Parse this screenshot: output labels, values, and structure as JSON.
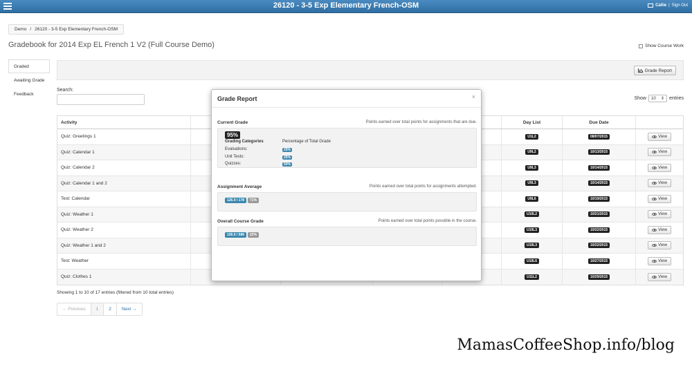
{
  "header": {
    "title": "26120 - 3-5 Exp Elementary French-OSM",
    "user_name": "Callie",
    "sign_out": "Sign Out"
  },
  "breadcrumb": [
    "Demo",
    "/",
    "26120 - 3-5 Exp Elementary French-OSM"
  ],
  "page_title": "Gradebook for 2014 Exp EL French 1 V2 (Full Course Demo)",
  "show_course_work": "Show Course Work",
  "side_tabs": [
    "Graded",
    "Awaiting Grade",
    "Feedback"
  ],
  "toolbar": {
    "grade_report_label": "Grade Report"
  },
  "search": {
    "label": "Search:",
    "value": ""
  },
  "entries": {
    "prefix": "Show",
    "value": "10",
    "suffix": "entries"
  },
  "table": {
    "headers": [
      "Activity",
      "",
      "",
      "",
      "",
      "Day List",
      "Due Date",
      ""
    ],
    "view_label": "View",
    "rows": [
      {
        "activity": "Quiz: Greetings 1",
        "day": "U1L2",
        "due": "08/07/2015"
      },
      {
        "activity": "Quiz: Calendar 1",
        "day": "U9L2",
        "due": "10/13/2015"
      },
      {
        "activity": "Quiz: Calendar 2",
        "day": "U9L3",
        "due": "10/14/2015"
      },
      {
        "activity": "Quiz: Calendar 1 and 2",
        "day": "U9L3",
        "due": "10/14/2015"
      },
      {
        "activity": "Test: Calendar",
        "day": "U9L6",
        "due": "10/19/2015"
      },
      {
        "activity": "Quiz: Weather 1",
        "day": "U10L2",
        "due": "10/21/2015"
      },
      {
        "activity": "Quiz: Weather 2",
        "day": "U10L3",
        "due": "10/22/2015"
      },
      {
        "activity": "Quiz: Weather 1 and 2",
        "day": "U10L3",
        "due": "10/22/2015"
      },
      {
        "activity": "Test: Weather",
        "day": "U10L6",
        "due": "10/27/2015"
      },
      {
        "activity": "Quiz: Clothes 1",
        "day": "U11L2",
        "due": "10/29/2015"
      }
    ]
  },
  "showing_text": "Showing 1 to 10 of 17 entries (filtered from 10 total entries)",
  "pagination": {
    "prev": "← Previous",
    "pages": [
      "1",
      "2"
    ],
    "next": "Next →"
  },
  "modal": {
    "title": "Grade Report",
    "close": "×",
    "current_grade": {
      "title": "Current Grade",
      "desc": "Points earned over total points for assignments that are due.",
      "value": "95%",
      "categories_head": "Grading Categories",
      "percent_head": "Percentage of Total Grade",
      "categories": [
        {
          "name": "Evaluations:",
          "pct": "25%"
        },
        {
          "name": "Unit Tests:",
          "pct": "25%"
        },
        {
          "name": "Quizzes:",
          "pct": "50%"
        }
      ]
    },
    "assignment_average": {
      "title": "Assignment Average",
      "desc": "Points earned over total points for assignments attempted.",
      "points": "126.0 / 178",
      "percent": "71%"
    },
    "overall": {
      "title": "Overall Course Grade",
      "desc": "Points earned over total points possible in the course.",
      "points": "126.0 / 586",
      "percent": "22%"
    }
  },
  "watermark": "MamasCoffeeShop.info/blog"
}
